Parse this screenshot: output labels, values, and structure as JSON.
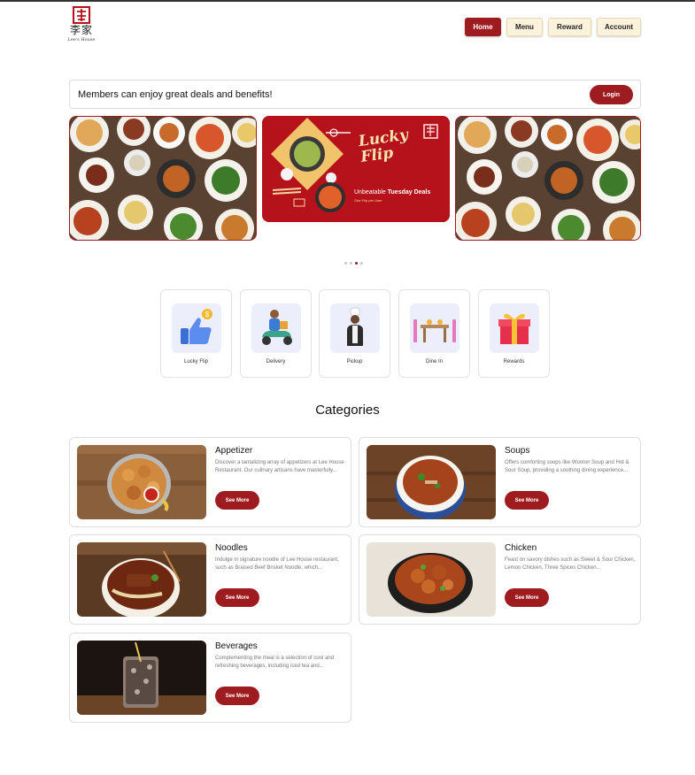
{
  "brand": {
    "name_cjk": "李家",
    "name_en": "Lee's House",
    "accent": "#9e1b1f",
    "cream": "#fdf3dd"
  },
  "nav": {
    "items": [
      {
        "label": "Home",
        "active": true
      },
      {
        "label": "Menu",
        "active": false
      },
      {
        "label": "Reward",
        "active": false
      },
      {
        "label": "Account",
        "active": false
      }
    ]
  },
  "member_banner": {
    "message": "Members can enjoy great deals and benefits!",
    "login_label": "Login"
  },
  "carousel": {
    "promo": {
      "headline": "Lucky Flip",
      "tagline_prefix": "Unbeatable ",
      "tagline_bold": "Tuesday Deals",
      "subline": "One Flip per User"
    },
    "slide_count": 4,
    "active_index": 2
  },
  "services": [
    {
      "label": "Lucky Flip",
      "icon": "thumbs-up-icon"
    },
    {
      "label": "Delivery",
      "icon": "delivery-scooter-icon"
    },
    {
      "label": "Pickup",
      "icon": "chef-icon"
    },
    {
      "label": "Dine In",
      "icon": "dining-table-icon"
    },
    {
      "label": "Rewards",
      "icon": "gift-icon"
    }
  ],
  "categories_title": "Categories",
  "categories": [
    {
      "name": "Appetizer",
      "desc": "Discover a tantalizing array of appetizers at Lee House Restaurant. Our culinary artisans have masterfully...",
      "button": "See More"
    },
    {
      "name": "Soups",
      "desc": "Offers comforting soups like Wonton Soup and Hot & Sour Soup, providing a soothing dining experience...",
      "button": "See More"
    },
    {
      "name": "Noodles",
      "desc": "Indulge in signature noodle of Lee House restaurant, such as Braised Beef Brisket Noodle, which...",
      "button": "See More"
    },
    {
      "name": "Chicken",
      "desc": "Feast on savory dishes such as Sweet & Sour Chicken, Lemon Chicken, Three Spices Chicken...",
      "button": "See More"
    },
    {
      "name": "Beverages",
      "desc": "Complementing the meal is a selection of cool and refreshing beverages, including iced tea and...",
      "button": "See More"
    }
  ]
}
